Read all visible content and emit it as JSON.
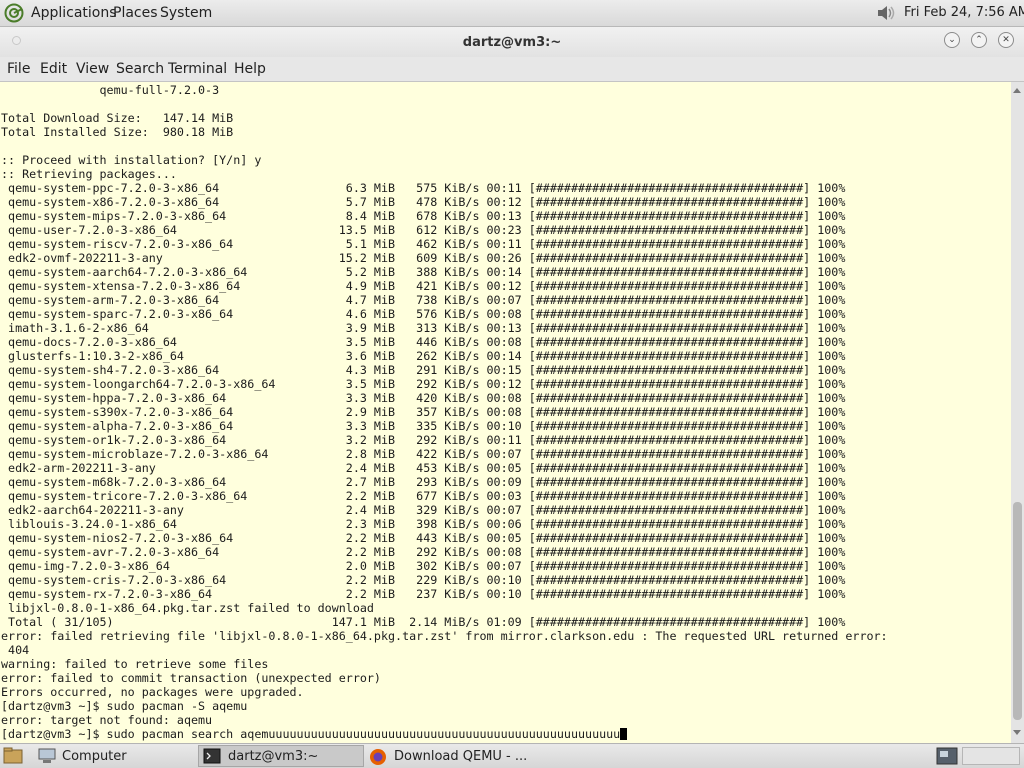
{
  "top_panel": {
    "menus": [
      "Applications",
      "Places",
      "System"
    ],
    "clock": "Fri Feb 24,  7:56 AM"
  },
  "window": {
    "title": "dartz@vm3:~",
    "menu": [
      "File",
      "Edit",
      "View",
      "Search",
      "Terminal",
      "Help"
    ]
  },
  "terminal": {
    "lines": [
      "              qemu-full-7.2.0-3",
      "",
      "Total Download Size:   147.14 MiB",
      "Total Installed Size:  980.18 MiB",
      "",
      ":: Proceed with installation? [Y/n] y",
      ":: Retrieving packages...",
      " qemu-system-ppc-7.2.0-3-x86_64                  6.3 MiB   575 KiB/s 00:11 [######################################] 100%",
      " qemu-system-x86-7.2.0-3-x86_64                  5.7 MiB   478 KiB/s 00:12 [######################################] 100%",
      " qemu-system-mips-7.2.0-3-x86_64                 8.4 MiB   678 KiB/s 00:13 [######################################] 100%",
      " qemu-user-7.2.0-3-x86_64                       13.5 MiB   612 KiB/s 00:23 [######################################] 100%",
      " qemu-system-riscv-7.2.0-3-x86_64                5.1 MiB   462 KiB/s 00:11 [######################################] 100%",
      " edk2-ovmf-202211-3-any                         15.2 MiB   609 KiB/s 00:26 [######################################] 100%",
      " qemu-system-aarch64-7.2.0-3-x86_64              5.2 MiB   388 KiB/s 00:14 [######################################] 100%",
      " qemu-system-xtensa-7.2.0-3-x86_64               4.9 MiB   421 KiB/s 00:12 [######################################] 100%",
      " qemu-system-arm-7.2.0-3-x86_64                  4.7 MiB   738 KiB/s 00:07 [######################################] 100%",
      " qemu-system-sparc-7.2.0-3-x86_64                4.6 MiB   576 KiB/s 00:08 [######################################] 100%",
      " imath-3.1.6-2-x86_64                            3.9 MiB   313 KiB/s 00:13 [######################################] 100%",
      " qemu-docs-7.2.0-3-x86_64                        3.5 MiB   446 KiB/s 00:08 [######################################] 100%",
      " glusterfs-1:10.3-2-x86_64                       3.6 MiB   262 KiB/s 00:14 [######################################] 100%",
      " qemu-system-sh4-7.2.0-3-x86_64                  4.3 MiB   291 KiB/s 00:15 [######################################] 100%",
      " qemu-system-loongarch64-7.2.0-3-x86_64          3.5 MiB   292 KiB/s 00:12 [######################################] 100%",
      " qemu-system-hppa-7.2.0-3-x86_64                 3.3 MiB   420 KiB/s 00:08 [######################################] 100%",
      " qemu-system-s390x-7.2.0-3-x86_64                2.9 MiB   357 KiB/s 00:08 [######################################] 100%",
      " qemu-system-alpha-7.2.0-3-x86_64                3.3 MiB   335 KiB/s 00:10 [######################################] 100%",
      " qemu-system-or1k-7.2.0-3-x86_64                 3.2 MiB   292 KiB/s 00:11 [######################################] 100%",
      " qemu-system-microblaze-7.2.0-3-x86_64           2.8 MiB   422 KiB/s 00:07 [######################################] 100%",
      " edk2-arm-202211-3-any                           2.4 MiB   453 KiB/s 00:05 [######################################] 100%",
      " qemu-system-m68k-7.2.0-3-x86_64                 2.7 MiB   293 KiB/s 00:09 [######################################] 100%",
      " qemu-system-tricore-7.2.0-3-x86_64              2.2 MiB   677 KiB/s 00:03 [######################################] 100%",
      " edk2-aarch64-202211-3-any                       2.4 MiB   329 KiB/s 00:07 [######################################] 100%",
      " liblouis-3.24.0-1-x86_64                        2.3 MiB   398 KiB/s 00:06 [######################################] 100%",
      " qemu-system-nios2-7.2.0-3-x86_64                2.2 MiB   443 KiB/s 00:05 [######################################] 100%",
      " qemu-system-avr-7.2.0-3-x86_64                  2.2 MiB   292 KiB/s 00:08 [######################################] 100%",
      " qemu-img-7.2.0-3-x86_64                         2.0 MiB   302 KiB/s 00:07 [######################################] 100%",
      " qemu-system-cris-7.2.0-3-x86_64                 2.2 MiB   229 KiB/s 00:10 [######################################] 100%",
      " qemu-system-rx-7.2.0-3-x86_64                   2.2 MiB   237 KiB/s 00:10 [######################################] 100%",
      " libjxl-0.8.0-1-x86_64.pkg.tar.zst failed to download",
      " Total ( 31/105)                               147.1 MiB  2.14 MiB/s 01:09 [######################################] 100%",
      "error: failed retrieving file 'libjxl-0.8.0-1-x86_64.pkg.tar.zst' from mirror.clarkson.edu : The requested URL returned error:",
      " 404",
      "warning: failed to retrieve some files",
      "error: failed to commit transaction (unexpected error)",
      "Errors occurred, no packages were upgraded.",
      "[dartz@vm3 ~]$ sudo pacman -S aqemu",
      "error: target not found: aqemu",
      "[dartz@vm3 ~]$ sudo pacman search aqemuuuuuuuuuuuuuuuuuuuuuuuuuuuuuuuuuuuuuuuuuuuuuuuuuu"
    ]
  },
  "taskbar": {
    "items": [
      "Computer",
      "dartz@vm3:~",
      "Download QEMU - ..."
    ]
  }
}
